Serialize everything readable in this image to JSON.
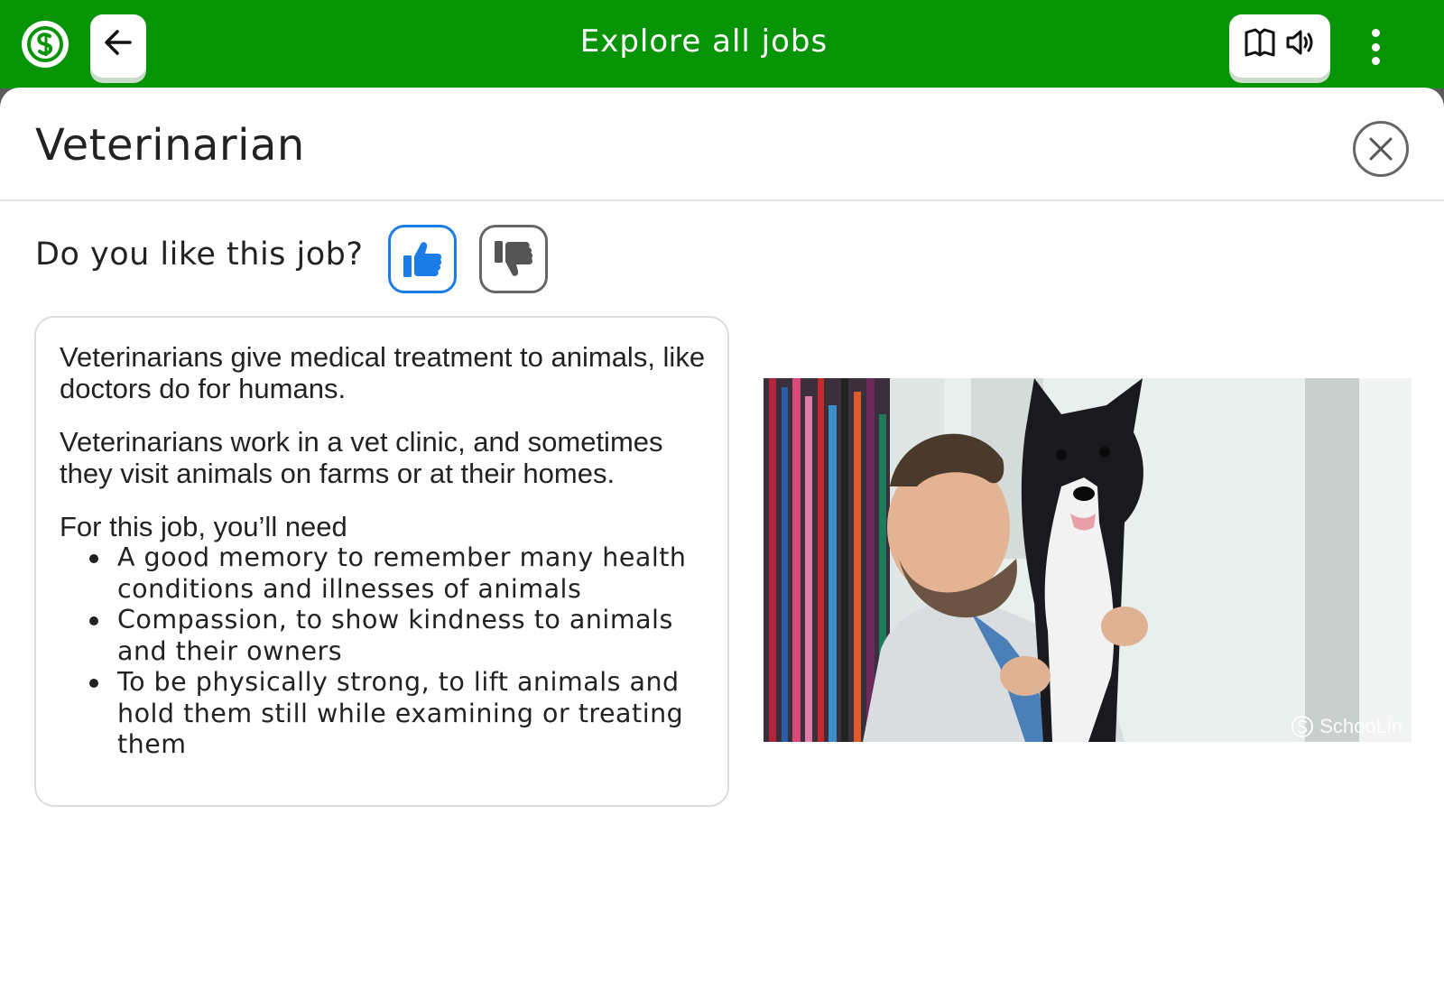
{
  "topbar": {
    "title": "Explore all jobs",
    "color": "#079407",
    "logo_icon": "schoolinks-logo-icon",
    "back_icon": "arrow-left-icon",
    "book_icon": "book-icon",
    "audio_icon": "speaker-icon",
    "menu_icon": "more-vertical-icon"
  },
  "job": {
    "title": "Veterinarian",
    "close_icon": "close-icon"
  },
  "feedback": {
    "question": "Do you like this job?",
    "like_icon": "thumbs-up-icon",
    "dislike_icon": "thumbs-down-icon",
    "selected": "like",
    "selected_color": "#1b7ce6"
  },
  "description": {
    "paragraphs": [
      "Veterinarians give medical treatment to animals, like doctors do for humans.",
      "Veterinarians work in a vet clinic, and sometimes they visit animals on farms or at their homes."
    ],
    "needs_heading": "For this job, you’ll need",
    "needs": [
      "A good memory to remember many health conditions and illnesses of animals",
      "Compassion, to show kindness to animals and their owners",
      "To be physically strong, to lift animals and hold them still while examining or treating them"
    ]
  },
  "image": {
    "subject": "veterinarian holding a black and white dog",
    "watermark": "SchooLin"
  }
}
